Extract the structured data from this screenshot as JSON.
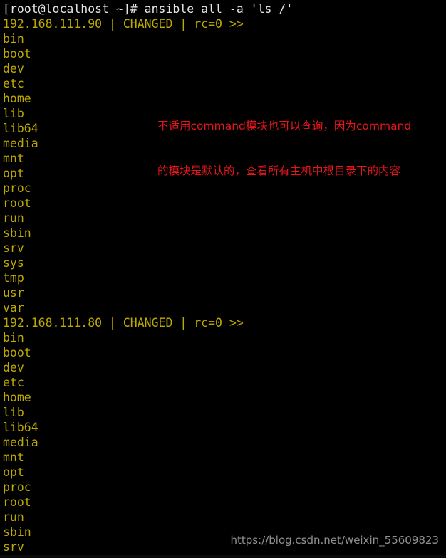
{
  "terminal": {
    "background_color": "#000000",
    "prompt_color": "#e6e6e6",
    "output_color": "#bdaa00",
    "annotation_color": "#e8161b",
    "prompt_line": "[root@localhost ~]# ansible all -a 'ls /'",
    "command": "ansible all -a 'ls /'",
    "user_host": "[root@localhost ~]#"
  },
  "hosts": [
    {
      "header": "192.168.111.90 | CHANGED | rc=0 >>",
      "ip": "192.168.111.90",
      "status": "CHANGED",
      "return_code": "rc=0",
      "entries": [
        "bin",
        "boot",
        "dev",
        "etc",
        "home",
        "lib",
        "lib64",
        "media",
        "mnt",
        "opt",
        "proc",
        "root",
        "run",
        "sbin",
        "srv",
        "sys",
        "tmp",
        "usr",
        "var"
      ]
    },
    {
      "header": "192.168.111.80 | CHANGED | rc=0 >>",
      "ip": "192.168.111.80",
      "status": "CHANGED",
      "return_code": "rc=0",
      "entries": [
        "bin",
        "boot",
        "dev",
        "etc",
        "home",
        "lib",
        "lib64",
        "media",
        "mnt",
        "opt",
        "proc",
        "root",
        "run",
        "sbin",
        "srv"
      ]
    }
  ],
  "annotation": {
    "line1": "不适用command模块也可以查询，因为command",
    "line2": "的模块是默认的，查看所有主机中根目录下的内容"
  },
  "watermark": {
    "text": "https://blog.csdn.net/weixin_55609823"
  }
}
